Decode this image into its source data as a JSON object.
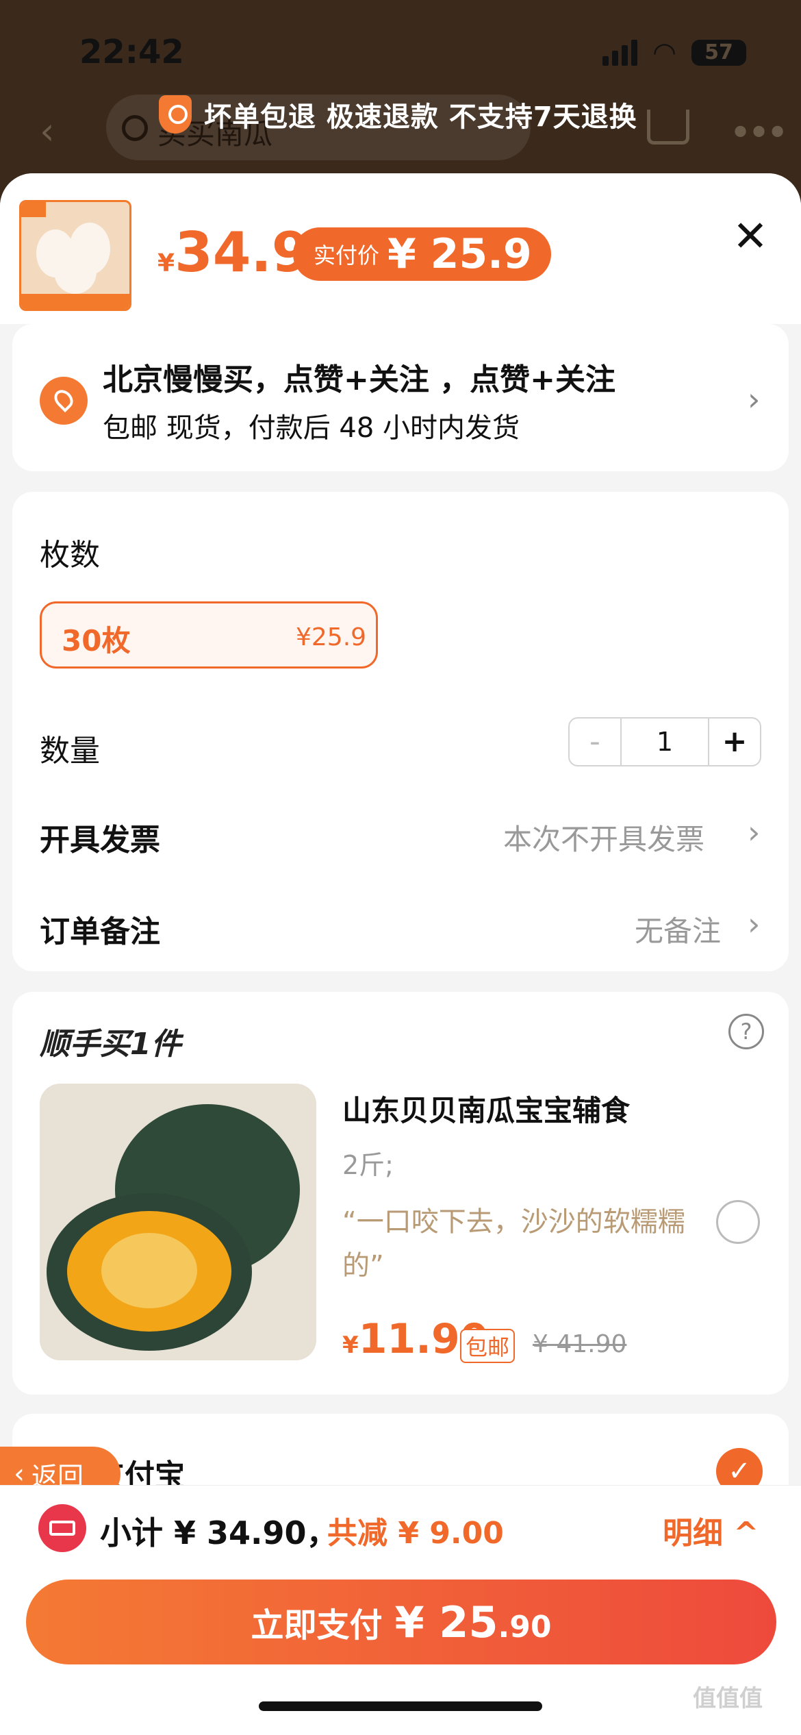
{
  "status_bar": {
    "time": "22:42",
    "battery": "57"
  },
  "nav": {
    "search_placeholder": "买买南瓜"
  },
  "banner": {
    "text": "坏单包退 极速退款 不支持7天退换"
  },
  "product": {
    "currency": "¥",
    "price": "34.9",
    "pay_label": "实付价",
    "pay_price": "¥ 25.9"
  },
  "address": {
    "line1": "北京慢慢买，点赞+关注 ，点赞+关注",
    "line2": "包邮  现货，付款后 48 小时内发货"
  },
  "spec": {
    "option_label": "枚数",
    "option_name": "30枚",
    "option_price": "¥25.9",
    "qty_label": "数量",
    "qty_minus": "-",
    "qty_value": "1",
    "qty_plus": "+"
  },
  "rows": [
    {
      "label": "开具发票",
      "value": "本次不开具发票"
    },
    {
      "label": "订单备注",
      "value": "无备注"
    }
  ],
  "addon": {
    "title": "顺手买1件",
    "help": "?",
    "name": "山东贝贝南瓜宝宝辅食",
    "spec": "2斤;",
    "quote": "“一口咬下去，沙沙的软糯糯的”",
    "currency": "¥",
    "price": "11.90",
    "ship_tag": "包邮",
    "orig_price": "¥ 41.90"
  },
  "payment": {
    "method": "支付宝"
  },
  "float_back": {
    "label": "返回"
  },
  "footer": {
    "subtotal": "小计 ¥ 34.90，",
    "discount": "共减 ¥ 9.00",
    "detail": "明细 ^",
    "pay_label": "立即支付",
    "pay_amount_main": "¥ 25",
    "pay_amount_decimal": ".90"
  },
  "watermark": "值值值",
  "colors": {
    "accent": "#f0682a",
    "accent_light": "#f47a34",
    "coupon": "#e8374a"
  }
}
